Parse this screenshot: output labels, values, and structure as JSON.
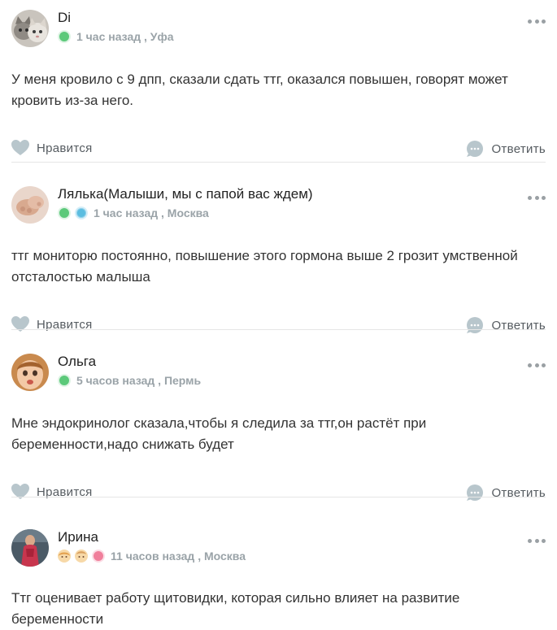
{
  "comments": [
    {
      "author": "Di",
      "meta": "1 час назад , Уфа",
      "text": "У меня кровило с 9 дпп, сказали сдать ттг, оказался повышен, говорят может кровить из-за него.",
      "like_label": "Нравится",
      "reply_label": "Ответить"
    },
    {
      "author": "Лялька(Малыши, мы с папой вас ждем)",
      "meta": "1 час назад , Москва",
      "text": "ттг мониторю постоянно, повышение этого гормона выше 2 грозит умственной отсталостью малыша",
      "like_label": "Нравится",
      "reply_label": "Ответить"
    },
    {
      "author": "Ольга",
      "meta": "5 часов назад , Пермь",
      "text": "Мне эндокринолог сказала,чтобы я следила за ттг,он растёт при беременности,надо снижать будет",
      "like_label": "Нравится",
      "reply_label": "Ответить"
    },
    {
      "author": "Ирина",
      "meta": "11 часов назад , Москва",
      "text": "Ттг оценивает работу щитовидки, которая сильно влияет на развитие беременности"
    }
  ],
  "colors": {
    "heart": "#b8c6cc",
    "reply_bubble": "#b8c6cc",
    "meta": "#9aa3a8"
  },
  "icons": {
    "like": "heart-icon",
    "reply": "chat-bubble-icon",
    "more": "more-dots-icon"
  }
}
